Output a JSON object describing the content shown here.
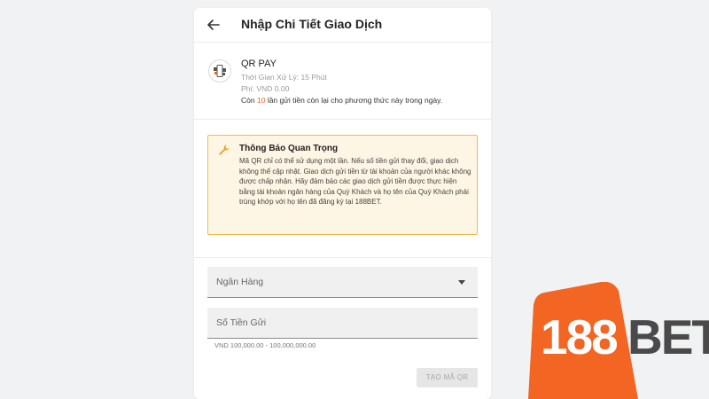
{
  "header": {
    "title": "Nhập Chi Tiết Giao Dịch",
    "back_icon": "arrow-left-icon"
  },
  "method": {
    "icon": "qr-phone-icon",
    "name": "QR PAY",
    "processing_time": "Thời Gian Xử Lý: 15 Phút",
    "fee": "Phí: VND 0.00",
    "remaining_prefix": "Còn",
    "remaining_count": "10",
    "remaining_suffix": "lần gửi tiền còn lại cho phương thức này trong ngày."
  },
  "notice": {
    "icon": "wrench-icon",
    "title": "Thông Báo Quan Trọng",
    "body": "Mã QR chỉ có thể sử dụng một lần. Nếu số tiền gửi thay đổi, giao dịch không thể cập nhật. Giao dịch gửi tiền từ tài khoản của người khác không được chấp nhận. Hãy đảm bảo các giao dịch gửi tiền được thực hiện bằng tài khoản ngân hàng của Quý Khách và họ tên của Quý Khách phải trùng khớp với họ tên đã đăng ký tại 188BET."
  },
  "form": {
    "bank_label": "Ngân Hàng",
    "amount_label": "Số Tiền Gửi",
    "amount_hint": "VND 100,000.00 - 100,000,000.00",
    "submit_label": "TẠO MÃ QR"
  },
  "brand": {
    "logo_num": "188",
    "logo_text": "BET",
    "accent": "#f26522",
    "warning_border": "#f0b84c",
    "warning_bg": "#fef6e4",
    "highlight": "#e8632b"
  }
}
